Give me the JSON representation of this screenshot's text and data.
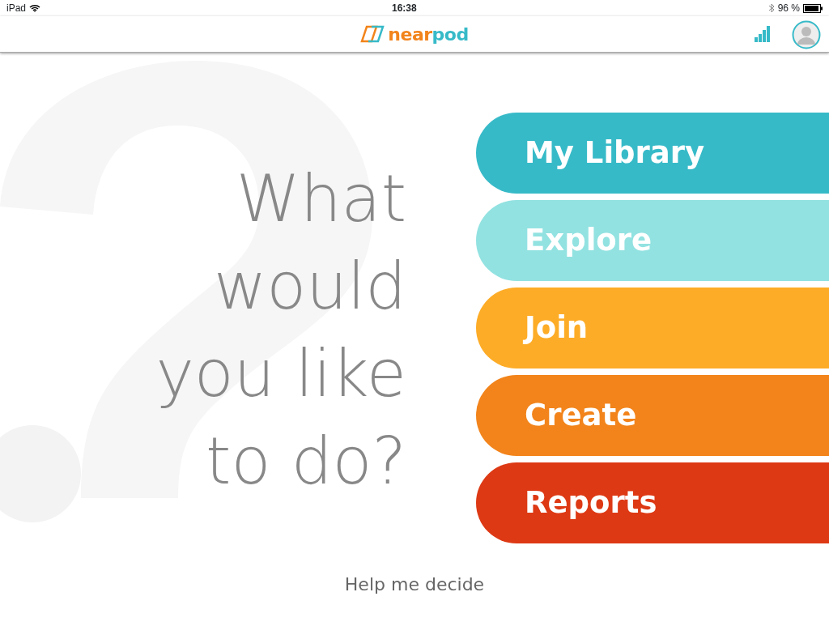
{
  "status_bar": {
    "device": "iPad",
    "time": "16:38",
    "battery": "96 %"
  },
  "header": {
    "logo": {
      "part_1": "near",
      "part_2": "pod"
    }
  },
  "heading_lines": [
    "What",
    "would",
    "you like",
    "to do?"
  ],
  "menu": [
    {
      "label": "My Library",
      "color": "#37bac8"
    },
    {
      "label": "Explore",
      "color": "#92e2e1"
    },
    {
      "label": "Join",
      "color": "#fdac27"
    },
    {
      "label": "Create",
      "color": "#f2841b"
    },
    {
      "label": "Reports",
      "color": "#dd3914"
    }
  ],
  "help_link": "Help me decide"
}
